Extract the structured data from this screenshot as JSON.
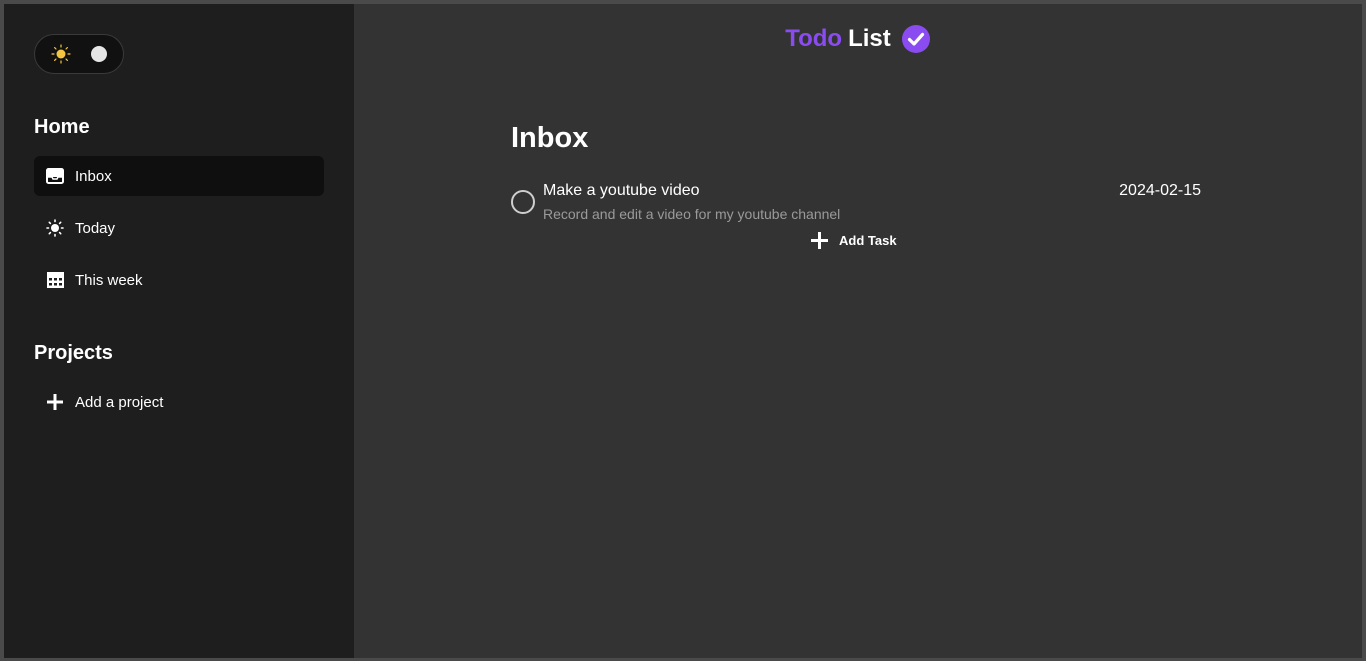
{
  "theme_toggle": {
    "icon": "sun-icon"
  },
  "sidebar": {
    "home_title": "Home",
    "items": [
      {
        "label": "Inbox",
        "icon": "inbox-icon",
        "active": true
      },
      {
        "label": "Today",
        "icon": "sun-icon",
        "active": false
      },
      {
        "label": "This week",
        "icon": "calendar-week-icon",
        "active": false
      }
    ],
    "projects_title": "Projects",
    "add_project_label": "Add a project"
  },
  "brand": {
    "part1": "Todo",
    "part2": "List",
    "accent": "#8a4cf0"
  },
  "main": {
    "title": "Inbox",
    "tasks": [
      {
        "name": "Make a youtube video",
        "description": "Record and edit a video for my youtube channel",
        "date": "2024-02-15"
      }
    ],
    "add_task_label": "Add Task"
  }
}
